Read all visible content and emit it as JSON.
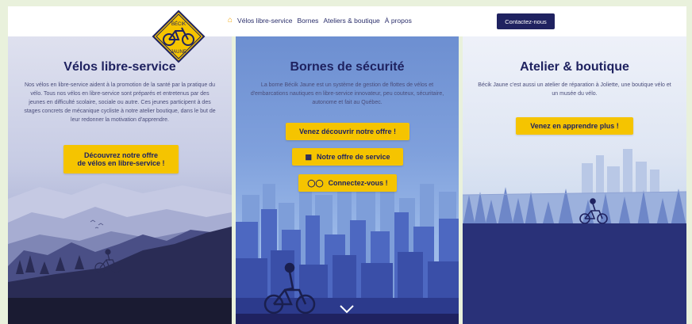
{
  "logo": {
    "top_text": "BÉCIK",
    "bottom_text": "JAUNE"
  },
  "nav": {
    "home_icon": "home-icon",
    "items": [
      "Vélos libre-service",
      "Bornes",
      "Ateliers & boutique",
      "À propos"
    ]
  },
  "contact_label": "Contactez-nous",
  "colors": {
    "navy": "#1f2260",
    "yellow": "#f5c400",
    "home_icon": "#f0a400"
  },
  "panels": [
    {
      "title": "Vélos libre-service",
      "text": "Nos vélos en libre-service aident à la promotion de la santé par la pratique du vélo. Tous nos vélos en libre-service sont préparés et entretenus par des jeunes en difficulté scolaire, sociale ou autre. Ces jeunes participent à des stages concrets de mécanique cycliste à notre atelier boutique, dans le but de leur redonner la motivation d'apprendre.",
      "button_line1": "Découvrez notre offre",
      "button_line2": "de vélos en libre-service !"
    },
    {
      "title": "Bornes de sécurité",
      "text": "La borne Bécik Jaune est un système de gestion de flottes de vélos et d'embarcations nautiques en libre-service innovateur, peu couteux, sécuritaire, autonome et fait au Québec.",
      "buttons": [
        {
          "label": "Venez découvrir notre offre !",
          "icon": ""
        },
        {
          "label": "Notre offre de service",
          "icon": "document-icon"
        },
        {
          "label": "Connectez-vous !",
          "icon": "bicycle-icon"
        }
      ]
    },
    {
      "title": "Atelier & boutique",
      "text": "Bécik Jaune c'est aussi un atelier de réparation à Joliette, une boutique vélo et un musée du vélo.",
      "button": "Venez en apprendre plus !"
    }
  ],
  "scroll_icon": "chevron-down-icon"
}
